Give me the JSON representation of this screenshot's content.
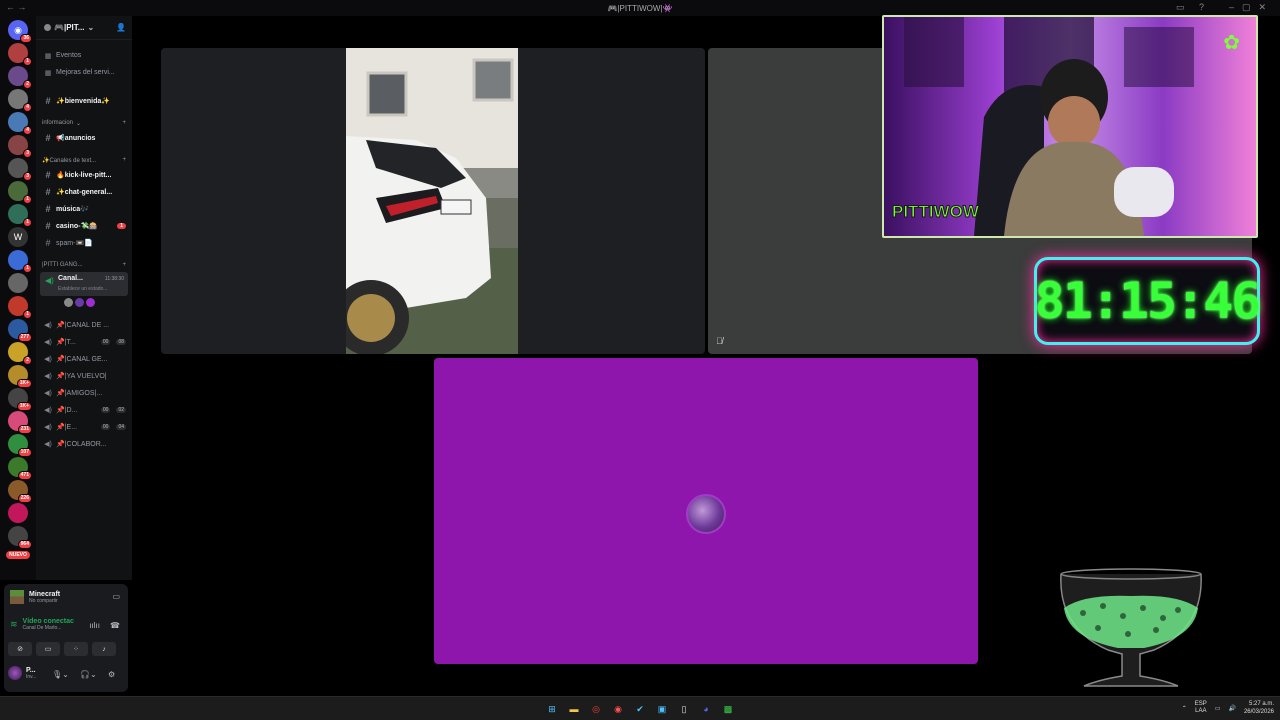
{
  "window": {
    "title": "🎮|PITTIWOW|👾"
  },
  "guilds": [
    {
      "name": "discord-home",
      "color": "#5865f2",
      "badge": "36",
      "glyph": "◉"
    },
    {
      "name": "guild-1",
      "color": "#b04040",
      "badge": "1"
    },
    {
      "name": "guild-2",
      "color": "#6a4a8a",
      "badge": "2"
    },
    {
      "name": "guild-3",
      "color": "#777",
      "badge": "4"
    },
    {
      "name": "guild-4",
      "color": "#4a7ab5",
      "badge": "4"
    },
    {
      "name": "guild-5",
      "color": "#884444",
      "badge": "3"
    },
    {
      "name": "guild-6",
      "color": "#555",
      "badge": "3"
    },
    {
      "name": "guild-7",
      "color": "#4a6a3a",
      "badge": "1"
    },
    {
      "name": "guild-8",
      "color": "#2f6f5a",
      "badge": "1"
    },
    {
      "name": "guild-w",
      "color": "#333",
      "badge": "",
      "glyph": "W"
    },
    {
      "name": "guild-9",
      "color": "#3b6bd6",
      "badge": "1"
    },
    {
      "name": "guild-10",
      "color": "#666",
      "badge": ""
    },
    {
      "name": "guild-11",
      "color": "#c0392b",
      "badge": "1"
    },
    {
      "name": "guild-12",
      "color": "#2c5aa0",
      "badge": "277"
    },
    {
      "name": "guild-13",
      "color": "#c9a227",
      "badge": "2"
    },
    {
      "name": "guild-14",
      "color": "#b48c2a",
      "badge": "1K+"
    },
    {
      "name": "guild-15",
      "color": "#444",
      "badge": "1K+"
    },
    {
      "name": "guild-16",
      "color": "#d64b7a",
      "badge": "231"
    },
    {
      "name": "guild-17",
      "color": "#2f8f3f",
      "badge": "107"
    },
    {
      "name": "guild-18",
      "color": "#3a7a2a",
      "badge": "471"
    },
    {
      "name": "guild-19",
      "color": "#8a5a2a",
      "badge": "226"
    },
    {
      "name": "guild-20",
      "color": "#c2185b",
      "badge": ""
    },
    {
      "name": "guild-21",
      "color": "#444",
      "badge": "964"
    }
  ],
  "nuevo_label": "NUEVO",
  "server": {
    "name": "🎮|PIT..."
  },
  "sidebar": {
    "events": "Eventos",
    "boosts": "Mejoras del servi...",
    "ch_bienvenida": "✨bienvenida✨",
    "cat_info": "informacion",
    "ch_anuncios": "📢anuncios",
    "cat_text": "✨Canales de text...",
    "ch_kick": "🔥kick-live-pitt...",
    "ch_chat": "✨chat-general...",
    "ch_musica": "música🎶",
    "ch_casino": "casino-💸🎰",
    "casino_badge": "1",
    "ch_spam": "spam-📼📄",
    "cat_gang": "|PITTI GANG...",
    "voice_active_name": "Canal...",
    "voice_active_time": "11:38:30",
    "voice_active_status": "Establece un estado...",
    "v1": "📌|CANAL DE ...",
    "v2": "📌|T...",
    "v2_cnt": "00",
    "v2_cnt2": "08",
    "v3": "📌|CANAL GE...",
    "v4": "📌|YA VUELVO|",
    "v5": "📌|AMIGOS|...",
    "v6": "📌|D...",
    "v6_cnt": "00",
    "v6_cnt2": "02",
    "v7": "📌|E...",
    "v7_cnt": "00",
    "v7_cnt2": "04",
    "v8": "📌|COLABOR..."
  },
  "activity": {
    "game": "Minecraft",
    "sub": "No compartir"
  },
  "voice_panel": {
    "status": "Vídeo conectac",
    "channel": "Canal De Marlo..."
  },
  "user": {
    "name": "P...",
    "status": "Inv..."
  },
  "stream": {
    "timer": "81:15:46",
    "cam_label": "PITTIWOW"
  },
  "tray": {
    "lang1": "ESP",
    "lang2": "LAA",
    "time": "5:27 a.m.",
    "date": "26/03/2026"
  },
  "colors": {
    "accent": "#5865f2",
    "online": "#23a559",
    "alert": "#f23f43",
    "tile_purple": "#8e16ad",
    "timer_green": "#39ff3a"
  }
}
